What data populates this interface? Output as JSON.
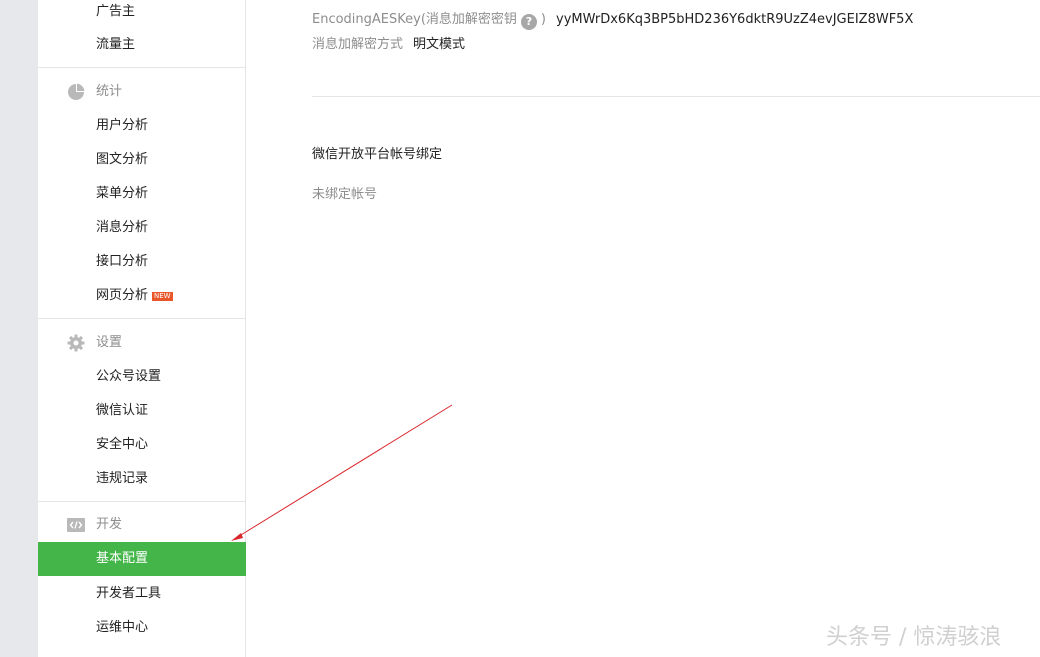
{
  "sidebar": {
    "top_items": [
      {
        "label": "广告主"
      },
      {
        "label": "流量主"
      }
    ],
    "groups": {
      "stats": {
        "title": "统计",
        "icon": "pie-chart-icon",
        "items": [
          {
            "label": "用户分析"
          },
          {
            "label": "图文分析"
          },
          {
            "label": "菜单分析"
          },
          {
            "label": "消息分析"
          },
          {
            "label": "接口分析"
          },
          {
            "label": "网页分析",
            "badge": "NEW"
          }
        ]
      },
      "settings": {
        "title": "设置",
        "icon": "gear-icon",
        "items": [
          {
            "label": "公众号设置"
          },
          {
            "label": "微信认证"
          },
          {
            "label": "安全中心"
          },
          {
            "label": "违规记录"
          }
        ]
      },
      "dev": {
        "title": "开发",
        "icon": "code-icon",
        "items": [
          {
            "label": "基本配置",
            "active": true
          },
          {
            "label": "开发者工具"
          },
          {
            "label": "运维中心"
          }
        ]
      }
    }
  },
  "main": {
    "aes_key": {
      "label": "EncodingAESKey(消息加解密密钥",
      "label_close": ")",
      "help": "?",
      "value": "yyMWrDx6Kq3BP5bHD236Y6dktR9UzZ4evJGEIZ8WF5X"
    },
    "encrypt_mode": {
      "label": "消息加解密方式",
      "value": "明文模式"
    },
    "open_platform": {
      "title": "微信开放平台帐号绑定",
      "status": "未绑定帐号"
    }
  },
  "watermark": "头条号 / 惊涛骇浪",
  "colors": {
    "active_bg": "#44b549",
    "muted_text": "#8d8d8d",
    "badge": "#e8562a",
    "annotation_arrow": "#d9262c"
  }
}
